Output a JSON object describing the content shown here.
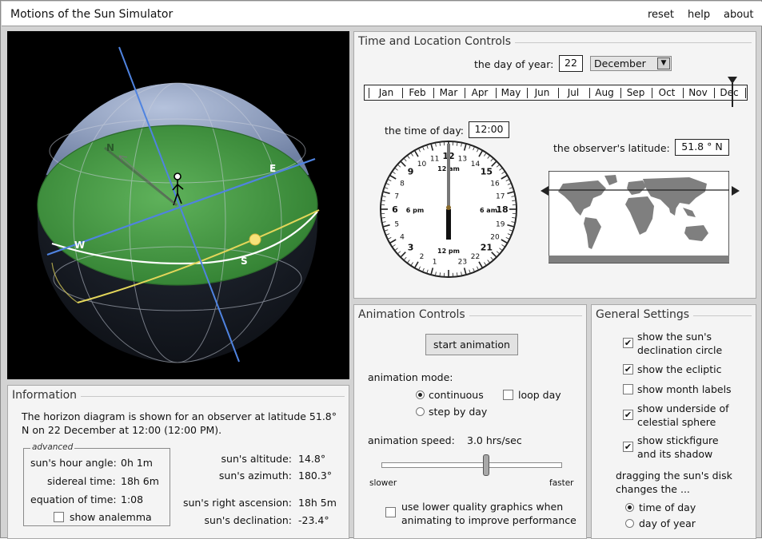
{
  "app": {
    "title": "Motions of the Sun Simulator",
    "links": {
      "reset": "reset",
      "help": "help",
      "about": "about"
    }
  },
  "viewport": {
    "direction_labels": {
      "north": "N",
      "east": "E",
      "west": "W",
      "south": "S"
    },
    "colors": {
      "ground": "#3f9a3f",
      "sky": "#8d9fc4",
      "equator": "#4f83e0",
      "ecliptic": "#e3d65a",
      "declination": "#ffffff"
    }
  },
  "time_location": {
    "title": "Time and Location Controls",
    "day_label": "the day of year:",
    "day_value": "22",
    "month_selected": "December",
    "months": [
      "Jan",
      "Feb",
      "Mar",
      "Apr",
      "May",
      "Jun",
      "Jul",
      "Aug",
      "Sep",
      "Oct",
      "Nov",
      "Dec"
    ],
    "time_label": "the time of day:",
    "time_value": "12:00",
    "latitude_label": "the observer's latitude:",
    "latitude_value": "51.8 ° N",
    "clock": {
      "outer_numbers": [
        "23",
        "1",
        "2",
        "3",
        "4",
        "5",
        "6",
        "7",
        "8",
        "9",
        "10",
        "11",
        "12",
        "13",
        "14",
        "15",
        "16",
        "17",
        "18",
        "19",
        "20",
        "21",
        "22"
      ],
      "bold_numbers": [
        "3",
        "6",
        "9",
        "12",
        "15",
        "18",
        "21"
      ],
      "inner_labels": {
        "top": "12 am",
        "right": "6 am",
        "bottom": "12 pm",
        "left": "6 pm"
      }
    }
  },
  "info": {
    "title": "Information",
    "description": "The horizon diagram is shown for an observer at latitude 51.8° N on 22 December at 12:00 (12:00 PM).",
    "advanced_legend": "advanced",
    "hour_angle_label": "sun's hour angle:",
    "hour_angle_value": "0h 1m",
    "sidereal_label": "sidereal time:",
    "sidereal_value": "18h 6m",
    "eq_time_label": "equation of time:",
    "eq_time_value": "1:08",
    "show_analemma": "show analemma",
    "altitude_label": "sun's altitude:",
    "altitude_value": "14.8°",
    "azimuth_label": "sun's azimuth:",
    "azimuth_value": "180.3°",
    "ra_label": "sun's right ascension:",
    "ra_value": "18h 5m",
    "dec_label": "sun's declination:",
    "dec_value": "-23.4°"
  },
  "animation": {
    "title": "Animation Controls",
    "start_button": "start animation",
    "mode_label": "animation mode:",
    "mode_continuous": "continuous",
    "mode_step": "step by day",
    "loop_day": "loop day",
    "speed_label": "animation speed:",
    "speed_value": "3.0 hrs/sec",
    "slower": "slower",
    "faster": "faster",
    "speed_slider_fraction": 0.58,
    "low_quality_line1": "use lower quality graphics when",
    "low_quality_line2": "animating to improve performance"
  },
  "settings": {
    "title": "General Settings",
    "declination_line1": "show the sun's",
    "declination_line2": "declination circle",
    "ecliptic": "show the ecliptic",
    "month_labels": "show month labels",
    "underside_line1": "show underside of",
    "underside_line2": "celestial sphere",
    "stick_line1": "show stickfigure",
    "stick_line2": "and its shadow",
    "drag_line1": "dragging the sun's disk",
    "drag_line2": "changes the ...",
    "drag_time": "time of day",
    "drag_year": "day of year"
  }
}
